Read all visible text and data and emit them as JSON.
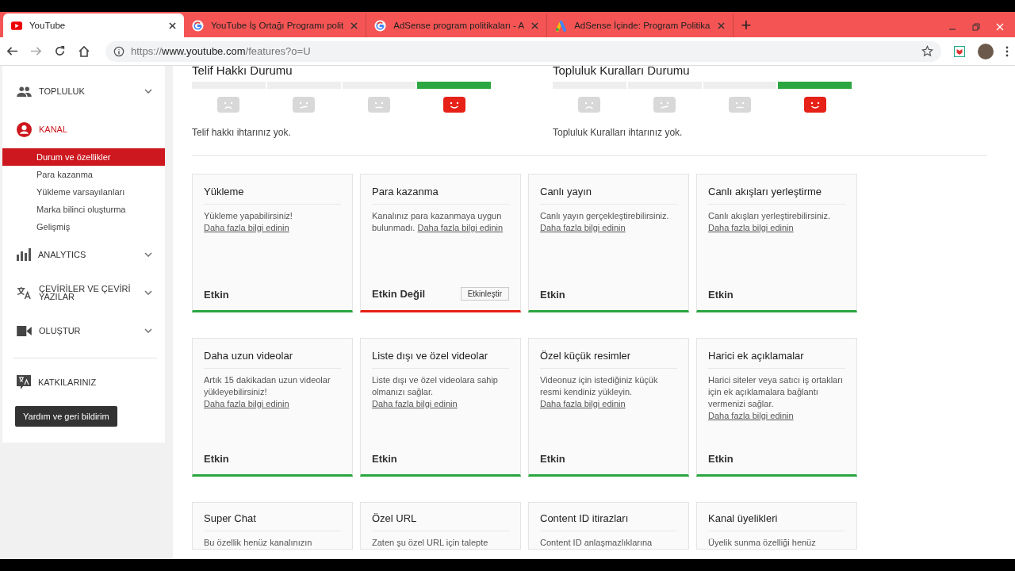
{
  "browser": {
    "tabs": [
      {
        "title": "YouTube",
        "kind": "youtube",
        "selected": true
      },
      {
        "title": "YouTube İş Ortağı Programı polit",
        "kind": "google",
        "selected": false
      },
      {
        "title": "AdSense program politikaları - A",
        "kind": "google",
        "selected": false
      },
      {
        "title": "AdSense İçinde: Program Politika",
        "kind": "adsense",
        "selected": false
      }
    ],
    "new_tab": "+",
    "url": {
      "scheme": "https://",
      "host": "www.youtube.com",
      "path": "/features?o=U"
    }
  },
  "sidebar": {
    "items": [
      {
        "label": "TOPLULUK",
        "kind": "people",
        "selected": false,
        "has_menu": true
      },
      {
        "label": "KANAL",
        "kind": "account",
        "selected": true,
        "has_menu": false,
        "children": [
          {
            "label": "Durum ve özellikler",
            "selected": true
          },
          {
            "label": "Para kazanma",
            "selected": false
          },
          {
            "label": "Yükleme varsayılanları",
            "selected": false
          },
          {
            "label": "Marka bilinci oluşturma",
            "selected": false
          },
          {
            "label": "Gelişmiş",
            "selected": false
          }
        ]
      },
      {
        "label": "ANALYTICS",
        "kind": "bars",
        "selected": false,
        "has_menu": true
      },
      {
        "label": "ÇEVİRİLER VE ÇEVİRİ YAZILAR",
        "kind": "translate",
        "selected": false,
        "has_menu": true
      },
      {
        "label": "OLUŞTUR",
        "kind": "camera",
        "selected": false,
        "has_menu": true
      }
    ],
    "footer_item": {
      "label": "KATKILARINIZ"
    },
    "help_button": "Yardım ve geri bildirim"
  },
  "status_sections": [
    {
      "title": "Telif Hakkı Durumu",
      "faces": [
        {
          "kind": "sad",
          "selected": false
        },
        {
          "kind": "meh",
          "selected": false
        },
        {
          "kind": "neutral",
          "selected": false
        },
        {
          "kind": "happy",
          "selected": true
        }
      ],
      "message": "Telif hakkı ihtarınız yok."
    },
    {
      "title": "Topluluk Kuralları Durumu",
      "faces": [
        {
          "kind": "sad",
          "selected": false
        },
        {
          "kind": "meh",
          "selected": false
        },
        {
          "kind": "neutral",
          "selected": false
        },
        {
          "kind": "happy",
          "selected": true
        }
      ],
      "message": "Topluluk Kuralları ihtarınız yok."
    }
  ],
  "features": [
    {
      "title": "Yükleme",
      "description": "Yükleme yapabilirsiniz!",
      "link": "Daha fazla bilgi edinin",
      "status": "Etkin",
      "enabled": true
    },
    {
      "title": "Para kazanma",
      "description": "Kanalınız para kazanmaya uygun bulunmadı.",
      "link": "Daha fazla bilgi edinin",
      "status": "Etkin Değil",
      "enabled": false,
      "action": "Etkinleştir"
    },
    {
      "title": "Canlı yayın",
      "description": "Canlı yayın gerçekleştirebilirsiniz.",
      "link": "Daha fazla bilgi edinin",
      "status": "Etkin",
      "enabled": true
    },
    {
      "title": "Canlı akışları yerleştirme",
      "description": "Canlı akışları yerleştirebilirsiniz.",
      "link": "Daha fazla bilgi edinin",
      "status": "Etkin",
      "enabled": true
    },
    {
      "title": "Daha uzun videolar",
      "description": "Artık 15 dakikadan uzun videolar yükleyebilirsiniz!",
      "link": "Daha fazla bilgi edinin",
      "status": "Etkin",
      "enabled": true
    },
    {
      "title": "Liste dışı ve özel videolar",
      "description": "Liste dışı ve özel videolara sahip olmanızı sağlar.",
      "link": "Daha fazla bilgi edinin",
      "status": "Etkin",
      "enabled": true
    },
    {
      "title": "Özel küçük resimler",
      "description": "Videonuz için istediğiniz küçük resmi kendiniz yükleyin.",
      "link": "Daha fazla bilgi edinin",
      "status": "Etkin",
      "enabled": true
    },
    {
      "title": "Harici ek açıklamalar",
      "description": "Harici siteler veya satıcı iş ortakları için ek açıklamalara bağlantı vermenizi sağlar.",
      "link": "Daha fazla bilgi edinin",
      "status": "Etkin",
      "enabled": true
    },
    {
      "title": "Super Chat",
      "description": "Bu özellik henüz kanalınızın"
    },
    {
      "title": "Özel URL",
      "description": "Zaten şu özel URL için talepte"
    },
    {
      "title": "Content ID itirazları",
      "description": "Content ID anlaşmazlıklarına"
    },
    {
      "title": "Kanal üyelikleri",
      "description": "Üyelik sunma özelliği henüz"
    }
  ]
}
